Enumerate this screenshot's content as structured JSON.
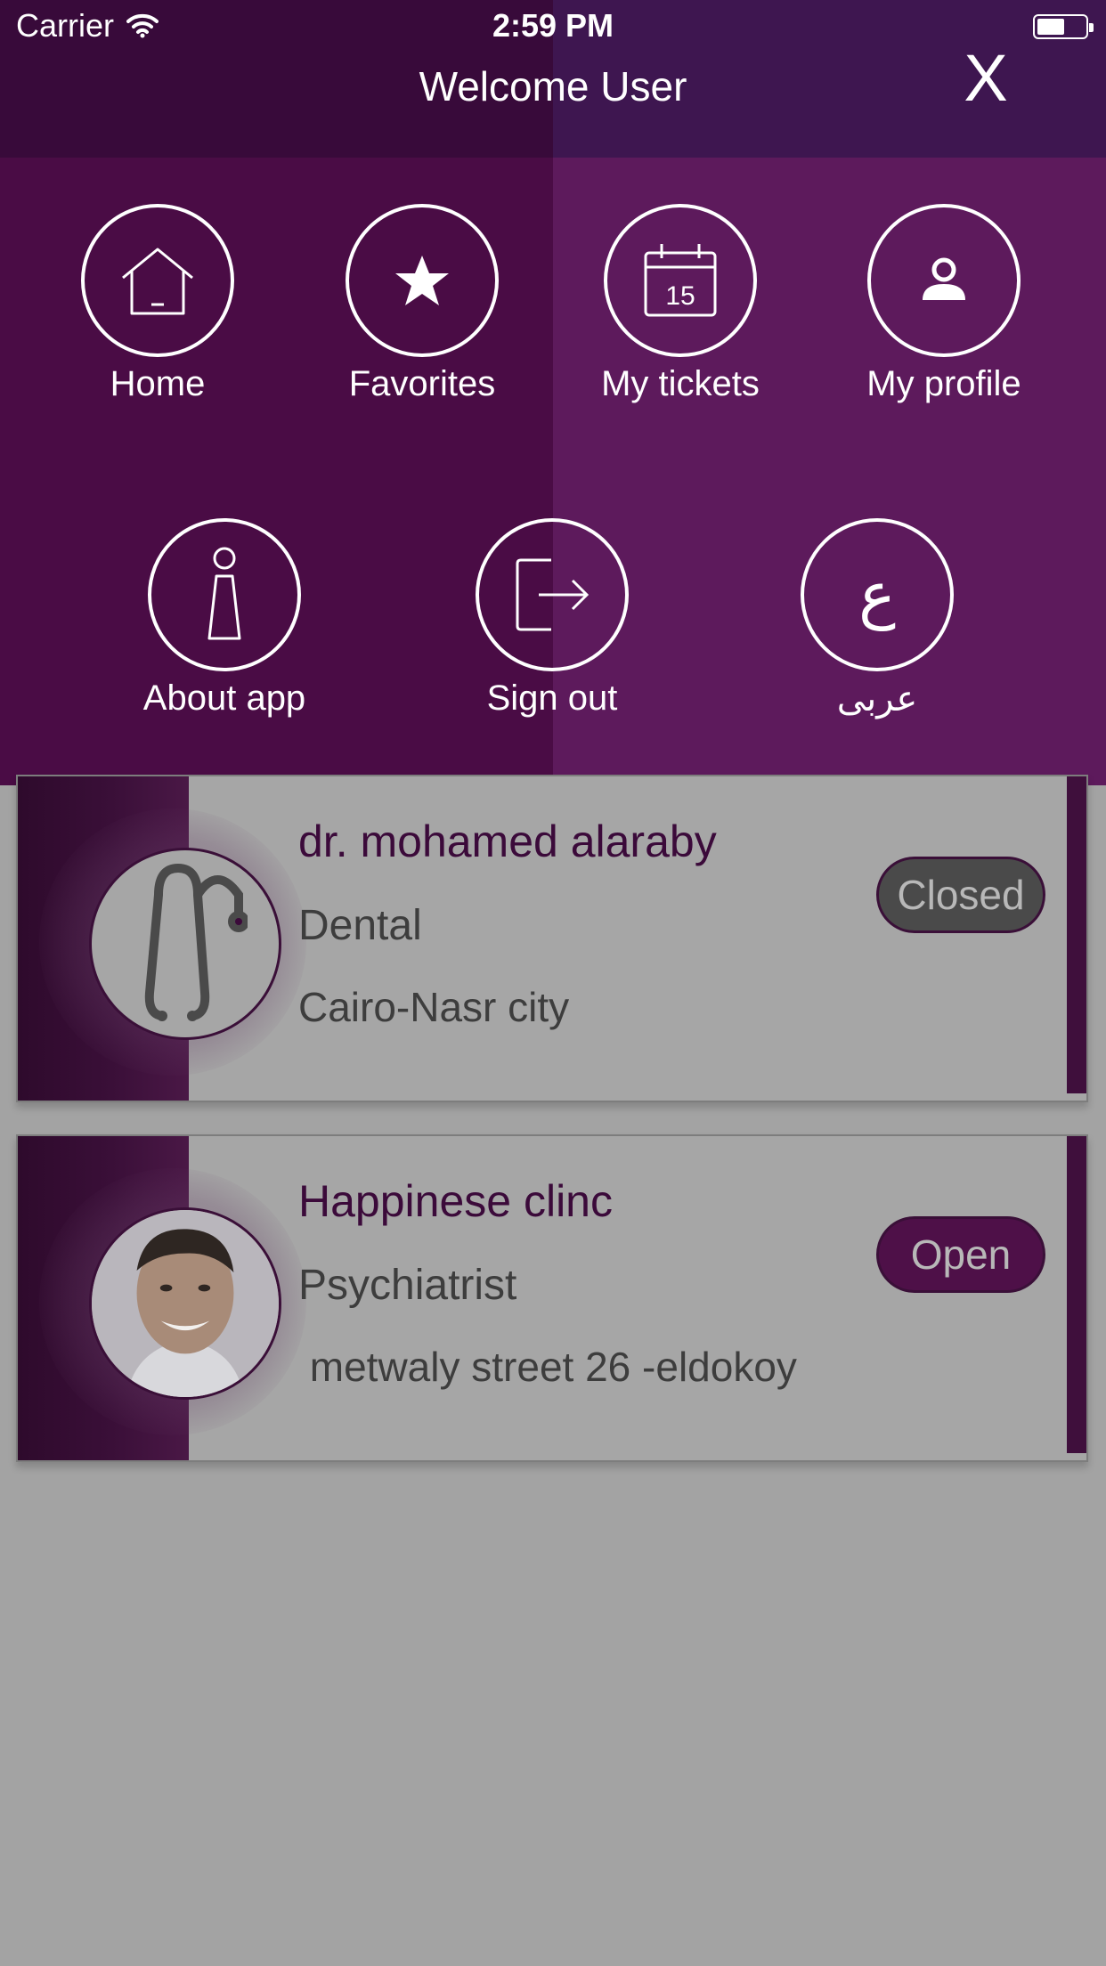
{
  "status_bar": {
    "carrier": "Carrier",
    "time": "2:59 PM"
  },
  "header": {
    "title": "Welcome User",
    "close_label": "X"
  },
  "menu": {
    "items": [
      {
        "label": "Home",
        "icon": "home-icon"
      },
      {
        "label": "Favorites",
        "icon": "star-icon"
      },
      {
        "label": "My tickets",
        "icon": "calendar-icon",
        "icon_text": "15"
      },
      {
        "label": "My profile",
        "icon": "person-icon"
      },
      {
        "label": "About app",
        "icon": "info-icon"
      },
      {
        "label": "Sign out",
        "icon": "sign-out-icon"
      },
      {
        "label": "عربى",
        "icon": "arabic-letter-icon",
        "icon_text": "ع"
      }
    ]
  },
  "doctors": [
    {
      "name": "dr. mohamed alaraby",
      "specialty": "Dental",
      "address": "Cairo-Nasr city",
      "status": "Closed",
      "avatar": "stethoscope-icon"
    },
    {
      "name": "Happinese clinc",
      "specialty": "Psychiatrist",
      "address": " metwaly street 26 -eldokoy",
      "status": "Open",
      "avatar": "doctor-photo"
    }
  ],
  "colors": {
    "menu_dark": "#4a0c45",
    "menu_light": "#5d1a5c",
    "overlay_gray": "#a3a3a3",
    "badge_closed": "#4a4a4a",
    "badge_open": "#4e1048"
  }
}
